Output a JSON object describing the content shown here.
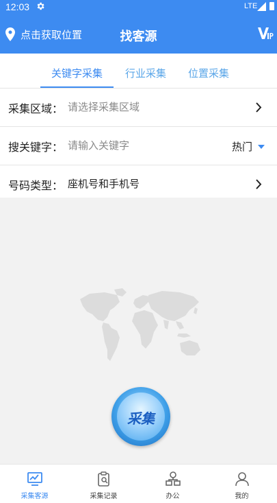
{
  "status_bar": {
    "time": "12:03",
    "network": "LTE"
  },
  "header": {
    "location_label": "点击获取位置",
    "title": "找客源"
  },
  "tabs": [
    {
      "label": "关键字采集",
      "active": true
    },
    {
      "label": "行业采集",
      "active": false
    },
    {
      "label": "位置采集",
      "active": false
    }
  ],
  "form": {
    "area": {
      "label": "采集区域：",
      "placeholder": "请选择采集区域"
    },
    "keyword": {
      "label": "搜关键字：",
      "placeholder": "请输入关键字",
      "hot_label": "热门"
    },
    "number_type": {
      "label": "号码类型：",
      "value": "座机号和手机号"
    }
  },
  "collect_button": {
    "label": "采集"
  },
  "bottom_nav": [
    {
      "label": "采集客源",
      "icon": "monitor-chart-icon",
      "active": true
    },
    {
      "label": "采集记录",
      "icon": "clipboard-search-icon",
      "active": false
    },
    {
      "label": "办公",
      "icon": "network-icon",
      "active": false
    },
    {
      "label": "我的",
      "icon": "user-icon",
      "active": false
    }
  ],
  "colors": {
    "primary": "#3d8bf1",
    "background": "#f2f2f2",
    "map": "#dcdcdc"
  }
}
